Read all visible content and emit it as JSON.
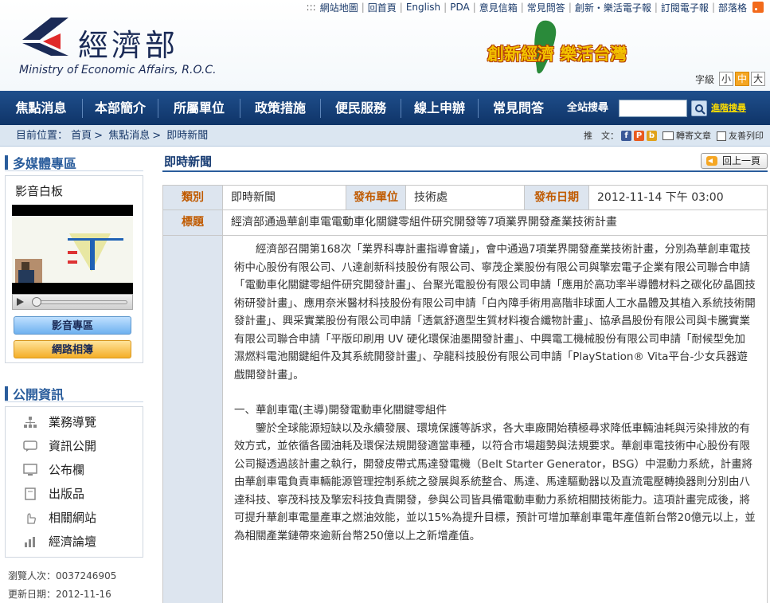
{
  "toplinks": [
    "網站地圖",
    "回首頁",
    "English",
    "PDA",
    "意見信箱",
    "常見問答",
    "創新・樂活電子報",
    "訂閱電子報",
    "部落格"
  ],
  "logo": {
    "cn": "經濟部",
    "en": "Ministry of Economic Affairs, R.O.C."
  },
  "banner": {
    "text": "創新經濟 樂活台灣"
  },
  "fontsize": {
    "label": "字級",
    "options": [
      "小",
      "中",
      "大"
    ],
    "active": "中"
  },
  "nav": [
    "焦點消息",
    "本部簡介",
    "所屬單位",
    "政策措施",
    "便民服務",
    "線上申辦",
    "常見問答"
  ],
  "search": {
    "label": "全站搜尋",
    "value": "",
    "advanced": "進階搜尋"
  },
  "breadcrumb": {
    "prefix": "目前位置：",
    "items": [
      "首頁",
      "焦點消息",
      "即時新聞"
    ]
  },
  "share": {
    "label": "推　文：",
    "forward": "轉寄文章",
    "print": "友善列印"
  },
  "sidebar": {
    "multimedia_title": "多媒體專區",
    "media_label": "影音白板",
    "btn_media": "影音專區",
    "btn_album": "網路相簿",
    "public_title": "公開資訊",
    "public_items": [
      "業務導覽",
      "資訊公開",
      "公布欄",
      "出版品",
      "相關網站",
      "經濟論壇"
    ],
    "visitors": "瀏覽人次：0037246905",
    "updated": "更新日期：2012-11-16"
  },
  "main": {
    "title": "即時新聞",
    "back": "回上一頁",
    "type_label": "類別",
    "type_value": "即時新聞",
    "unit_label": "發布單位",
    "unit_value": "技術處",
    "date_label": "發布日期",
    "date_value": "2012-11-14 下午 03:00",
    "subject_label": "標題",
    "subject_value": "經濟部通過華創車電電動車化關鍵零組件研究開發等7項業界開發產業技術計畫",
    "p1": "經濟部召開第168次「業界科專計畫指導會議」，會中通過7項業界開發產業技術計畫，分別為華創車電技術中心股份有限公司、八達創新科技股份有限公司、寧茂企業股份有限公司與擎宏電子企業有限公司聯合申請「電動車化關鍵零組件研究開發計畫」、台聚光電股份有限公司申請「應用於高功率半導體材料之碳化矽晶圓技術研發計畫」、應用奈米醫材科技股份有限公司申請「白內障手術用高階非球面人工水晶體及其植入系統技術開發計畫」、興采實業股份有限公司申請「透氣舒適型生質材料複合纖物計畫」、協承昌股份有限公司與卡騰實業有限公司聯合申請「平版印刷用 UV 硬化環保油墨開發計畫」、中興電工機械股份有限公司申請「耐候型免加濕燃料電池關鍵組件及其系統開發計畫」、孕龍科技股份有限公司申請「PlayStation® Vita平台-少女兵器遊戲開發計畫」。",
    "h1": "一、華創車電(主導)開發電動車化關鍵零組件",
    "p2": "鑒於全球能源短缺以及永續發展、環境保護等訴求，各大車廠開始積極尋求降低車輛油耗與污染排放的有效方式，並依循各國油耗及環保法規開發適當車種，以符合市場趨勢與法規要求。華創車電技術中心股份有限公司擬透過該計畫之執行，開發皮帶式馬達發電機（Belt Starter Generator，BSG）中混動力系統，計畫將由華創車電負責車輛能源管理控制系統之發展與系統整合、馬達、馬達驅動器以及直流電壓轉換器則分別由八達科技、寧茂科技及擎宏科技負責開發，參與公司皆具備電動車動力系統相關技術能力。這項計畫完成後，將可提升華創車電量產車之燃油效能，並以15%為提升目標，預計可增加華創車電年產值新台幣20億元以上，並為相關產業鏈帶來逾新台幣250億以上之新增產值。"
  }
}
